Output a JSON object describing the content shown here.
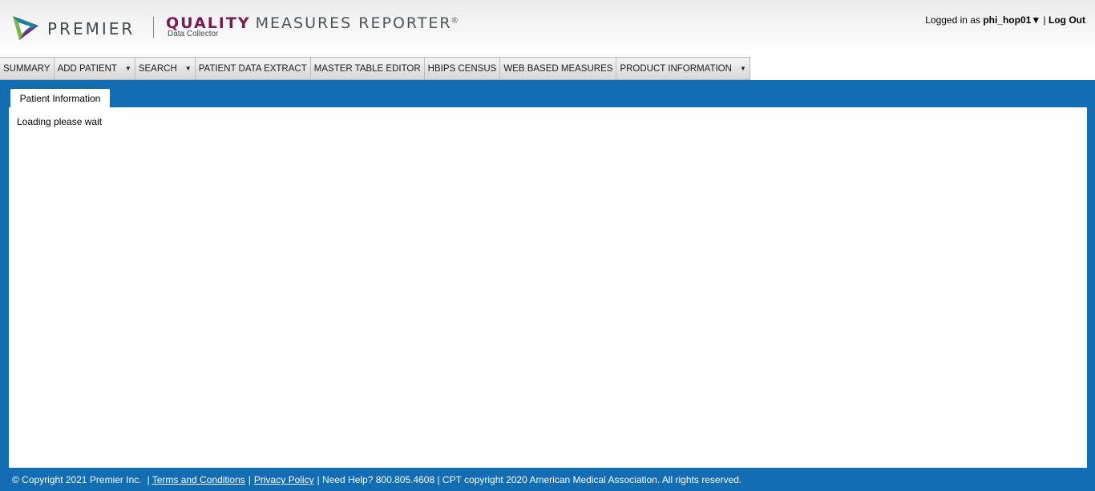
{
  "header": {
    "brand": "PREMIER",
    "product_bold": "QUALITY",
    "product_rest": "MEASURES REPORTER",
    "product_reg": "®",
    "product_sub": "Data Collector",
    "logged_in_prefix": "Logged in as",
    "username": "phi_hop01▼",
    "separator": "|",
    "logout": "Log Out",
    "logo_colors": {
      "green": "#7ab648",
      "teal": "#1a7fa0",
      "purple": "#6b2c8a"
    }
  },
  "nav": {
    "items": [
      {
        "label": "SUMMARY"
      },
      {
        "label": "ADD PATIENT",
        "caret": "▼"
      },
      {
        "label": "SEARCH",
        "caret": "▼"
      },
      {
        "label": "PATIENT DATA EXTRACT"
      },
      {
        "label": "MASTER TABLE EDITOR"
      },
      {
        "label": "HBIPS CENSUS"
      },
      {
        "label": "WEB BASED MEASURES"
      },
      {
        "label": "PRODUCT INFORMATION",
        "caret": "▼"
      }
    ]
  },
  "main": {
    "tab_label": "Patient Information",
    "loading_text": "Loading please wait",
    "accent_color": "#126db3"
  },
  "footer": {
    "copyright": "© Copyright 2021 Premier Inc.",
    "sep1": "|",
    "terms": "Terms and Conditions",
    "sep2": "|",
    "privacy": "Privacy Policy",
    "help": "| Need Help? 800.805.4608 | CPT copyright 2020 American Medical Association. All rights reserved."
  }
}
